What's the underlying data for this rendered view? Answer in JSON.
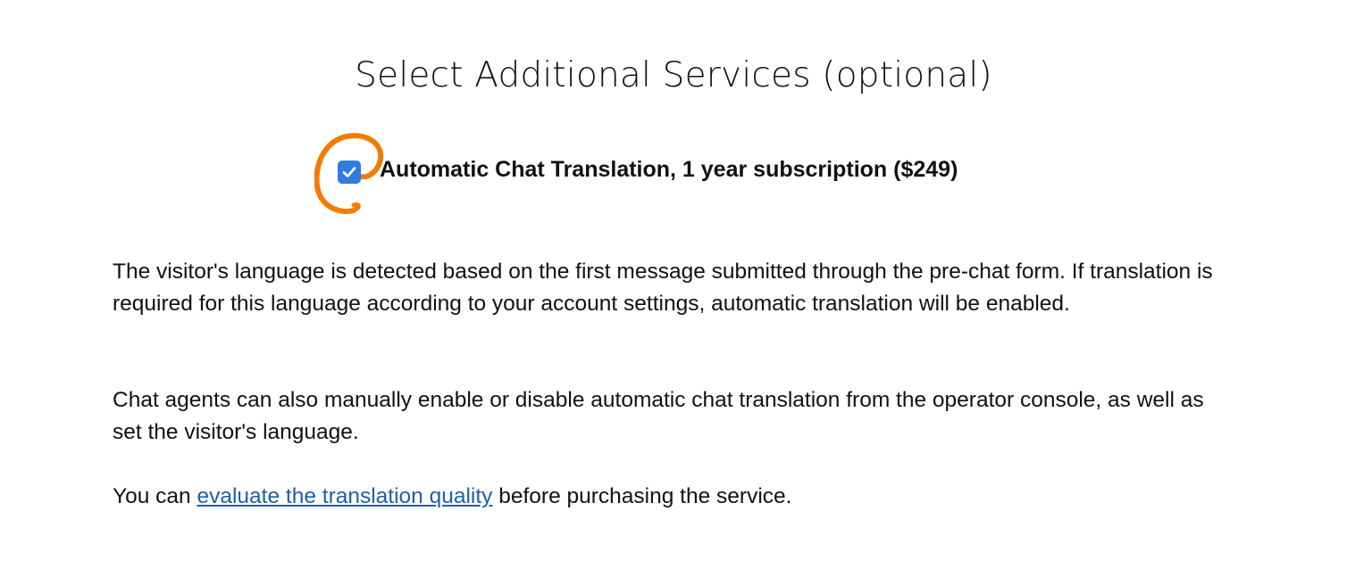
{
  "header": {
    "title": "Select Additional Services (optional)"
  },
  "service_option": {
    "checked": true,
    "label": "Automatic Chat Translation, 1 year subscription ($249)",
    "checkbox_color": "#2f7de1",
    "highlight_color": "#f07d00"
  },
  "description": {
    "paragraph_1": "The visitor's language is detected based on the first message submitted through the pre-chat form. If translation is required for this language according to your account settings, automatic translation will be enabled.",
    "paragraph_2": "Chat agents can also manually enable or disable automatic chat translation from the operator console, as well as set the visitor's language.",
    "paragraph_3_prefix": "You can ",
    "paragraph_3_link": "evaluate the translation quality",
    "paragraph_3_suffix": " before purchasing the service."
  },
  "icons": {
    "checkbox": "check-icon",
    "annotation": "highlight-circle-icon"
  }
}
